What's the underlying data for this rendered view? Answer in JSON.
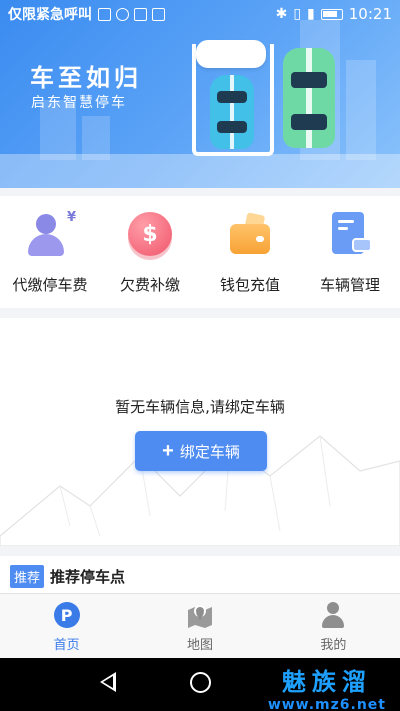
{
  "status_bar": {
    "carrier": "仅限紧急呼叫",
    "time": "10:21"
  },
  "banner": {
    "title": "车至如归",
    "subtitle": "启东智慧停车"
  },
  "actions": [
    {
      "label": "代缴停车费",
      "icon": "person-payment-icon"
    },
    {
      "label": "欠费补缴",
      "icon": "coin-dollar-icon",
      "glyph": "$"
    },
    {
      "label": "钱包充值",
      "icon": "wallet-icon"
    },
    {
      "label": "车辆管理",
      "icon": "vehicle-document-icon"
    }
  ],
  "empty_state": {
    "message": "暂无车辆信息,请绑定车辆",
    "button_label": "绑定车辆"
  },
  "recommend": {
    "badge": "推荐",
    "title": "推荐停车点"
  },
  "tabbar": [
    {
      "label": "首页",
      "icon": "parking-p-icon",
      "glyph": "P",
      "active": true
    },
    {
      "label": "地图",
      "icon": "map-pin-icon",
      "active": false
    },
    {
      "label": "我的",
      "icon": "user-icon",
      "active": false
    }
  ],
  "watermark": {
    "main": "魅族溜",
    "url": "www.mz6.net"
  },
  "colors": {
    "accent": "#4f8cf2",
    "banner_blue": "#3a8bf0",
    "tab_active": "#3a7be8"
  }
}
